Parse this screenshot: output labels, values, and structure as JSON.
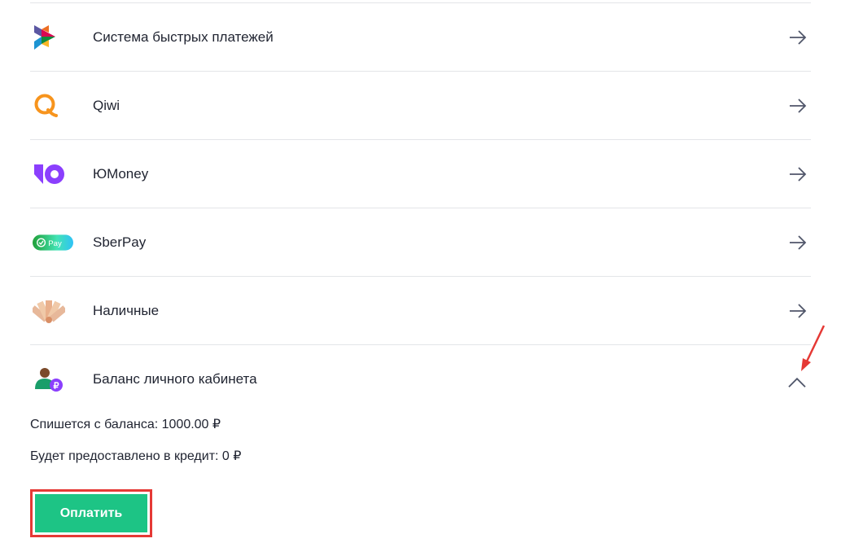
{
  "payment_methods": [
    {
      "label": "Система быстрых платежей",
      "icon": "sbp-icon"
    },
    {
      "label": "Qiwi",
      "icon": "qiwi-icon"
    },
    {
      "label": "ЮMoney",
      "icon": "yoomoney-icon"
    },
    {
      "label": "SberPay",
      "icon": "sberpay-icon",
      "badge": "Pay"
    },
    {
      "label": "Наличные",
      "icon": "cash-icon"
    },
    {
      "label": "Баланс личного кабинета",
      "icon": "account-balance-icon",
      "expanded": true
    }
  ],
  "balance": {
    "debit_text": "Спишется с баланса: 1000.00 ₽",
    "credit_text": "Будет предоставлено в кредит: 0 ₽"
  },
  "pay_button_label": "Оплатить",
  "colors": {
    "accent_green": "#1dc485",
    "highlight_red": "#e53935",
    "yoomoney_purple": "#8b3ffd",
    "qiwi_orange": "#f7941d",
    "sber_green": "#21a038"
  }
}
